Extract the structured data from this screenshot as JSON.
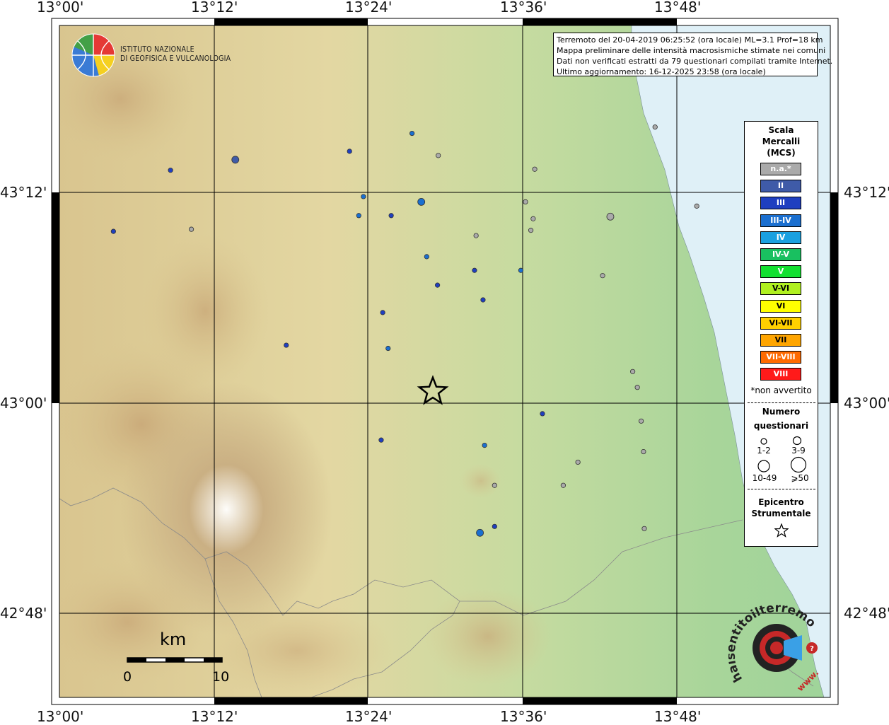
{
  "map": {
    "lon_labels": [
      "13°00'",
      "13°12'",
      "13°24'",
      "13°36'",
      "13°48'"
    ],
    "lat_labels": [
      "43°12'",
      "43°00'",
      "42°48'"
    ]
  },
  "header": {
    "logo_line1": "ISTITUTO NAZIONALE",
    "logo_line2": "DI GEOFISICA E VULCANOLOGIA"
  },
  "info": {
    "line1": "Terremoto del 20-04-2019 06:25:52 (ora locale) ML=3.1 Prof=18 km",
    "line2": "Mappa preliminare delle intensità macrosismiche stimate nei comuni",
    "line3": "Dati non verificati estratti da 79 questionari compilati tramite Internet.",
    "line4": "Ultimo aggiornamento: 16-12-2025 23:58 (ora locale)"
  },
  "legend": {
    "title1": "Scala",
    "title2": "Mercalli",
    "title3": "(MCS)",
    "classes": [
      {
        "label": "n.a.*",
        "color": "#aaaaaa"
      },
      {
        "label": "II",
        "color": "#3f5ba8"
      },
      {
        "label": "III",
        "color": "#1f3fc0"
      },
      {
        "label": "III-IV",
        "color": "#1a6fd0"
      },
      {
        "label": "IV",
        "color": "#1aa0e0"
      },
      {
        "label": "IV-V",
        "color": "#19c060"
      },
      {
        "label": "V",
        "color": "#11e030"
      },
      {
        "label": "V-VI",
        "color": "#b0f020"
      },
      {
        "label": "VI",
        "color": "#ffff00"
      },
      {
        "label": "VI-VII",
        "color": "#ffd000"
      },
      {
        "label": "VII",
        "color": "#ffa500"
      },
      {
        "label": "VII-VIII",
        "color": "#ff6a00"
      },
      {
        "label": "VIII",
        "color": "#ff1a1a"
      }
    ],
    "note": "*non avvertito",
    "count_title1": "Numero",
    "count_title2": "questionari",
    "count_labels": [
      "1-2",
      "3-9",
      "10-49",
      "⩾50"
    ],
    "epi_title1": "Epicentro",
    "epi_title2": "Strumentale"
  },
  "scalebar": {
    "unit": "km",
    "start": "0",
    "end": "10"
  },
  "badge": {
    "text": "haisentitoilterremoto.it",
    "www": "www."
  },
  "points": [
    {
      "lon": 13.457,
      "lat": 43.256,
      "intensity": "III-IV",
      "responses": "1-2"
    },
    {
      "lon": 13.376,
      "lat": 43.239,
      "intensity": "III",
      "responses": "1-2"
    },
    {
      "lon": 13.491,
      "lat": 43.235,
      "intensity": "n.a.*",
      "responses": "1-2"
    },
    {
      "lon": 13.228,
      "lat": 43.231,
      "intensity": "II",
      "responses": "3-9"
    },
    {
      "lon": 13.144,
      "lat": 43.221,
      "intensity": "III",
      "responses": "1-2"
    },
    {
      "lon": 13.616,
      "lat": 43.222,
      "intensity": "n.a.*",
      "responses": "1-2"
    },
    {
      "lon": 13.772,
      "lat": 43.262,
      "intensity": "n.a.*",
      "responses": "1-2"
    },
    {
      "lon": 13.394,
      "lat": 43.196,
      "intensity": "III-IV",
      "responses": "1-2"
    },
    {
      "lon": 13.469,
      "lat": 43.191,
      "intensity": "III-IV",
      "responses": "3-9"
    },
    {
      "lon": 13.604,
      "lat": 43.191,
      "intensity": "n.a.*",
      "responses": "1-2"
    },
    {
      "lon": 13.826,
      "lat": 43.187,
      "intensity": "n.a.*",
      "responses": "1-2"
    },
    {
      "lon": 13.388,
      "lat": 43.178,
      "intensity": "III-IV",
      "responses": "1-2"
    },
    {
      "lon": 13.43,
      "lat": 43.178,
      "intensity": "III",
      "responses": "1-2"
    },
    {
      "lon": 13.714,
      "lat": 43.177,
      "intensity": "n.a.*",
      "responses": "3-9"
    },
    {
      "lon": 13.614,
      "lat": 43.175,
      "intensity": "n.a.*",
      "responses": "1-2"
    },
    {
      "lon": 13.07,
      "lat": 43.163,
      "intensity": "III",
      "responses": "1-2"
    },
    {
      "lon": 13.171,
      "lat": 43.165,
      "intensity": "n.a.*",
      "responses": "1-2"
    },
    {
      "lon": 13.611,
      "lat": 43.164,
      "intensity": "n.a.*",
      "responses": "1-2"
    },
    {
      "lon": 13.54,
      "lat": 43.159,
      "intensity": "n.a.*",
      "responses": "1-2"
    },
    {
      "lon": 13.476,
      "lat": 43.139,
      "intensity": "III-IV",
      "responses": "1-2"
    },
    {
      "lon": 13.538,
      "lat": 43.126,
      "intensity": "III",
      "responses": "1-2"
    },
    {
      "lon": 13.598,
      "lat": 43.126,
      "intensity": "III-IV",
      "responses": "1-2"
    },
    {
      "lon": 13.704,
      "lat": 43.121,
      "intensity": "n.a.*",
      "responses": "1-2"
    },
    {
      "lon": 13.49,
      "lat": 43.112,
      "intensity": "III",
      "responses": "1-2"
    },
    {
      "lon": 13.549,
      "lat": 43.098,
      "intensity": "III",
      "responses": "1-2"
    },
    {
      "lon": 13.419,
      "lat": 43.086,
      "intensity": "III",
      "responses": "1-2"
    },
    {
      "lon": 13.294,
      "lat": 43.055,
      "intensity": "III",
      "responses": "1-2"
    },
    {
      "lon": 13.426,
      "lat": 43.052,
      "intensity": "III-IV",
      "responses": "1-2"
    },
    {
      "lon": 13.743,
      "lat": 43.03,
      "intensity": "n.a.*",
      "responses": "1-2"
    },
    {
      "lon": 13.749,
      "lat": 43.015,
      "intensity": "n.a.*",
      "responses": "1-2"
    },
    {
      "lon": 13.626,
      "lat": 42.99,
      "intensity": "III",
      "responses": "1-2"
    },
    {
      "lon": 13.754,
      "lat": 42.983,
      "intensity": "n.a.*",
      "responses": "1-2"
    },
    {
      "lon": 13.417,
      "lat": 42.965,
      "intensity": "III",
      "responses": "1-2"
    },
    {
      "lon": 13.551,
      "lat": 42.96,
      "intensity": "III-IV",
      "responses": "1-2"
    },
    {
      "lon": 13.757,
      "lat": 42.954,
      "intensity": "n.a.*",
      "responses": "1-2"
    },
    {
      "lon": 13.672,
      "lat": 42.944,
      "intensity": "n.a.*",
      "responses": "1-2"
    },
    {
      "lon": 13.653,
      "lat": 42.922,
      "intensity": "n.a.*",
      "responses": "1-2"
    },
    {
      "lon": 13.564,
      "lat": 42.883,
      "intensity": "III",
      "responses": "1-2"
    },
    {
      "lon": 13.545,
      "lat": 42.877,
      "intensity": "III-IV",
      "responses": "3-9"
    },
    {
      "lon": 13.758,
      "lat": 42.881,
      "intensity": "n.a.*",
      "responses": "1-2"
    },
    {
      "lon": 13.564,
      "lat": 42.922,
      "intensity": "n.a.*",
      "responses": "1-2"
    }
  ],
  "epicenter": {
    "lon": 13.484,
    "lat": 43.011
  }
}
